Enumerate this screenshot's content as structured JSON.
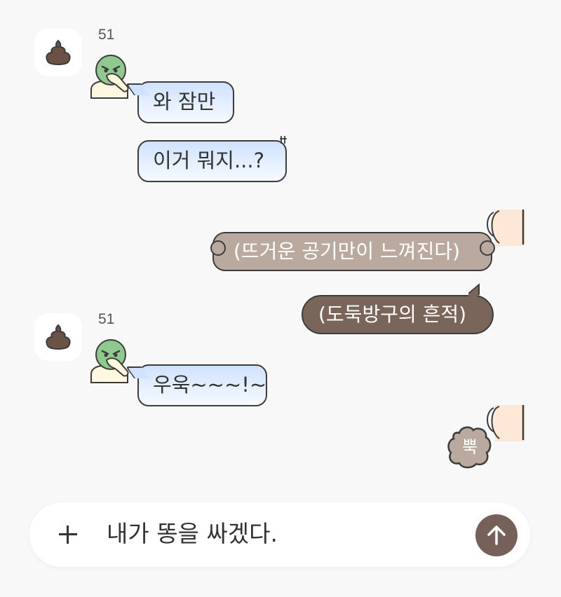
{
  "chat": {
    "group1": {
      "sender_avatar_icon": "poop-icon",
      "count": "51",
      "sticker": "disgusted-green-face-sticker",
      "messages": [
        "와 잠만",
        "이거 뭐지...?"
      ]
    },
    "thought_bubble": "(뜨거운 공기만이 느껴진다)",
    "narration_bubble": "(도둑방구의 흔적)",
    "group2": {
      "sender_avatar_icon": "poop-icon",
      "count": "51",
      "sticker": "disgusted-green-face-sticker",
      "messages": [
        "우욱~~~!~"
      ]
    },
    "fart_sound": "뿍"
  },
  "input": {
    "plus_icon": "plus-icon",
    "value": "내가 똥을 싸겠다.",
    "send_icon": "arrow-up-icon"
  },
  "colors": {
    "background": "#f8f8f8",
    "incoming_bubble_top": "#cfe2ff",
    "thought_bubble": "#b9a99e",
    "narration_bubble": "#7a655b",
    "send_button": "#76605a",
    "skin": "#fde8d8"
  }
}
